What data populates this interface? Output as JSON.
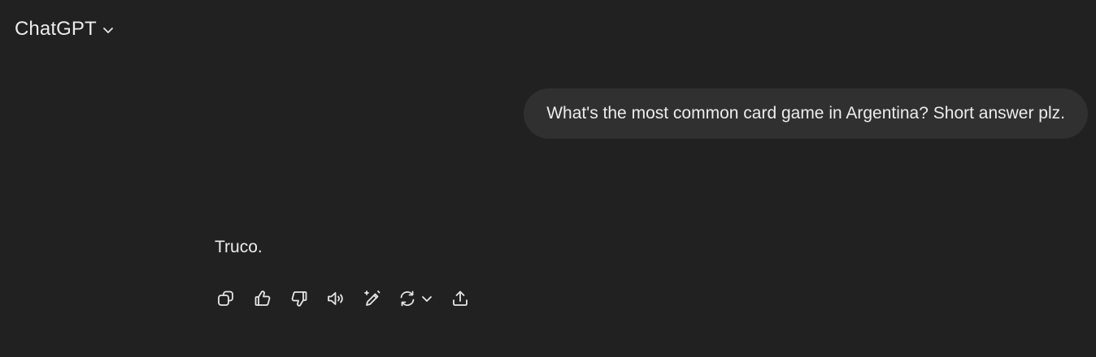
{
  "header": {
    "model_name": "ChatGPT",
    "dropdown_icon": "chevron-down-icon"
  },
  "conversation": {
    "user_message": "What's the most common card game in Argentina? Short answer plz.",
    "assistant_message": "Truco."
  },
  "message_actions": [
    {
      "icon": "copy-icon"
    },
    {
      "icon": "thumbs-up-icon"
    },
    {
      "icon": "thumbs-down-icon"
    },
    {
      "icon": "read-aloud-icon"
    },
    {
      "icon": "edit-icon"
    },
    {
      "icon": "regenerate-icon"
    },
    {
      "icon": "share-icon"
    }
  ],
  "colors": {
    "background": "#212121",
    "bubble": "#303030",
    "text": "#ececec"
  }
}
